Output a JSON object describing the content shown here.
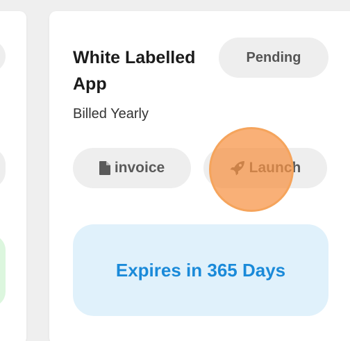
{
  "card": {
    "title": "White Labelled App",
    "billing_cycle": "Billed Yearly",
    "status": "Pending",
    "actions": {
      "invoice_label": "invoice",
      "launch_label": "Launch"
    },
    "expiry_text": "Expires in 365 Days"
  },
  "icons": {
    "invoice": "document-icon",
    "launch": "rocket-icon"
  },
  "colors": {
    "title": "#1b1b1b",
    "pill_bg": "#eeeeee",
    "pill_text": "#5a5a5a",
    "expiry_bg": "#e0f1fb",
    "expiry_text": "#1a8ad9",
    "click_marker": "#f79242",
    "neighbor_green": "#dcf6de"
  }
}
